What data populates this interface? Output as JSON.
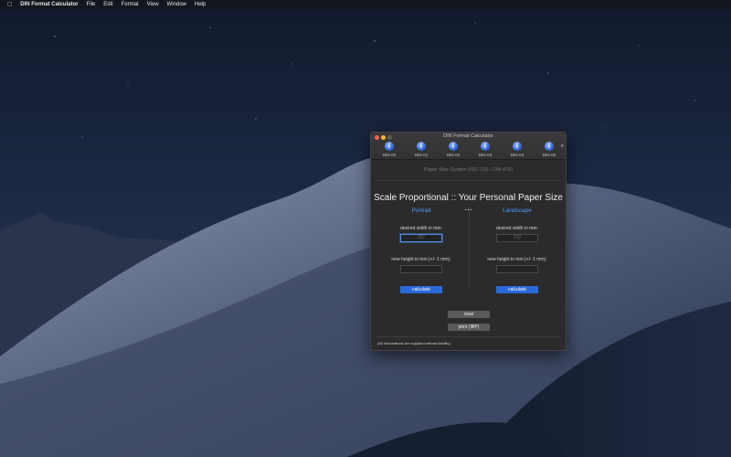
{
  "menubar": {
    "apple_icon": "apple-icon",
    "app_name": "DIN Format Calculator",
    "items": [
      "File",
      "Edit",
      "Format",
      "View",
      "Window",
      "Help"
    ]
  },
  "window": {
    "title": "DIN Format Calculator",
    "toolbar": [
      {
        "label": "DIN A0",
        "icon": "info-icon"
      },
      {
        "label": "DIN A1",
        "icon": "info-icon"
      },
      {
        "label": "DIN A2",
        "icon": "info-icon"
      },
      {
        "label": "DIN A3",
        "icon": "info-icon"
      },
      {
        "label": "DIN A4",
        "icon": "info-icon"
      },
      {
        "label": "DIN A5",
        "icon": "info-icon"
      }
    ],
    "toolbar_more": "»",
    "subtitle": "Paper Size System (ISO 216 / DIN 476)",
    "heading": "Scale Proportional :: Your Personal Paper Size ...",
    "portrait": {
      "title": "Portrait",
      "width_label": "desired width in mm:",
      "width_placeholder": "297",
      "height_label": "new height in mm (+/- 1 mm):",
      "height_value": "",
      "calculate_label": "calculate"
    },
    "landscape": {
      "title": "Landscape",
      "width_label": "desired width in mm:",
      "width_placeholder": "210",
      "height_label": "new height in mm (+/- 1 mm):",
      "height_value": "",
      "calculate_label": "calculate"
    },
    "clear_label": "clear",
    "print_label": "print (⌘P)",
    "disclaimer": "(All informations are supplied without liability)"
  },
  "colors": {
    "accent_blue": "#2a6ad8",
    "column_title_blue": "#4e9bff",
    "close": "#fe5f57",
    "minimize": "#febc2e"
  }
}
